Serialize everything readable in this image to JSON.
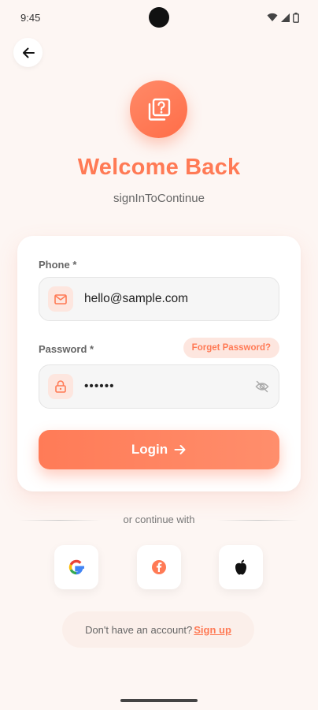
{
  "status_bar": {
    "time": "9:45"
  },
  "header": {
    "title": "Welcome Back",
    "subtitle": "signInToContinue"
  },
  "form": {
    "phone_label": "Phone *",
    "phone_value": "hello@sample.com",
    "password_label": "Password *",
    "password_value": "••••••",
    "forget_password": "Forget Password?",
    "login_label": "Login"
  },
  "social": {
    "divider_text": "or continue with",
    "providers": [
      {
        "name": "Google",
        "icon": "google-icon"
      },
      {
        "name": "Facebook",
        "icon": "facebook-icon"
      },
      {
        "name": "Apple",
        "icon": "apple-icon"
      }
    ]
  },
  "footer": {
    "prompt": "Don't have an account?",
    "signup_label": " Sign up"
  },
  "colors": {
    "accent": "#ff7a55",
    "background": "#fdf6f3"
  }
}
